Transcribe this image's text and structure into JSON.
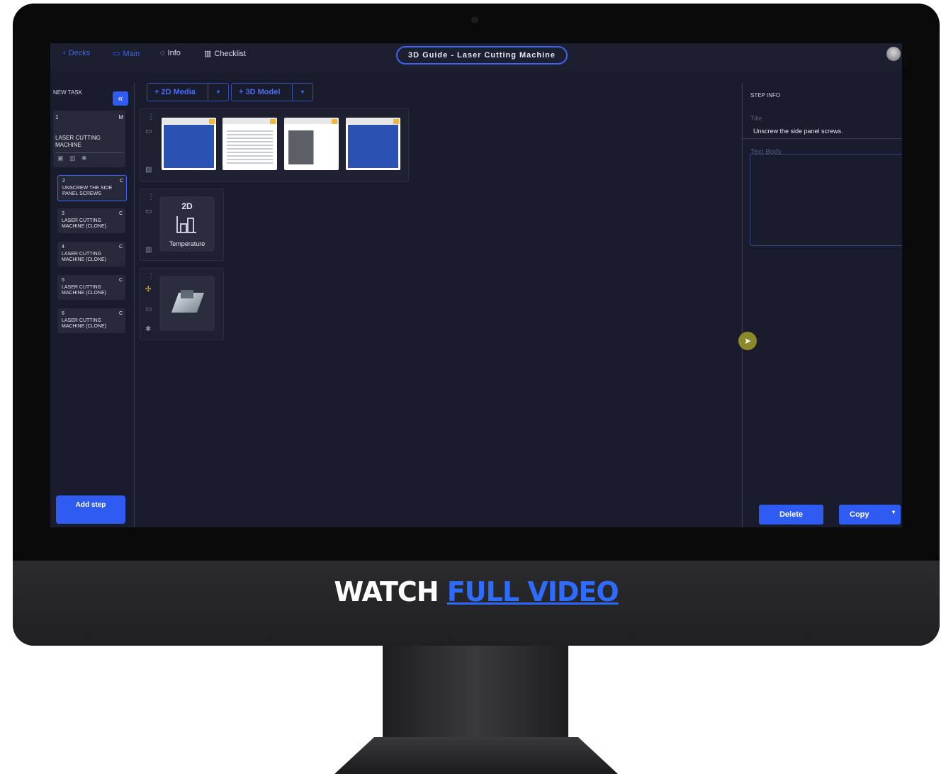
{
  "promo": {
    "watch": "WATCH",
    "full_video": "FULL VIDEO"
  },
  "topbar": {
    "decks": "Decks",
    "main": "Main",
    "info": "Info",
    "checklist": "Checklist",
    "deck_title": "3D Guide - Laser Cutting Machine"
  },
  "left_panel": {
    "new_task": "NEW TASK",
    "add_step": "Add step",
    "steps": [
      {
        "num": "1",
        "tag": "M",
        "label": "LASER CUTTING MACHINE"
      },
      {
        "num": "2",
        "tag": "C",
        "label": "UNSCREW THE SIDE PANEL SCREWS"
      },
      {
        "num": "3",
        "tag": "C",
        "label": "LASER CUTTING MACHINE (CLONE)"
      },
      {
        "num": "4",
        "tag": "C",
        "label": "LASER CUTTING MACHINE (CLONE)"
      },
      {
        "num": "5",
        "tag": "C",
        "label": "LASER CUTTING MACHINE (CLONE)"
      },
      {
        "num": "6",
        "tag": "C",
        "label": "LASER CUTTING MACHINE (CLONE)"
      }
    ]
  },
  "toolbar": {
    "add_2d_media": "2D Media",
    "add_3d_model": "3D Model"
  },
  "media": {
    "chart_card_title": "2D",
    "chart_card_label": "Temperature"
  },
  "right_panel": {
    "step_info": "STEP INFO",
    "title_label": "Title",
    "title_value": "Unscrew the side panel screws.",
    "text_body_label": "Text Body",
    "delete": "Delete",
    "copy": "Copy"
  },
  "colors": {
    "accent": "#2f5bf1",
    "background": "#191c2c",
    "panel": "#262939"
  }
}
